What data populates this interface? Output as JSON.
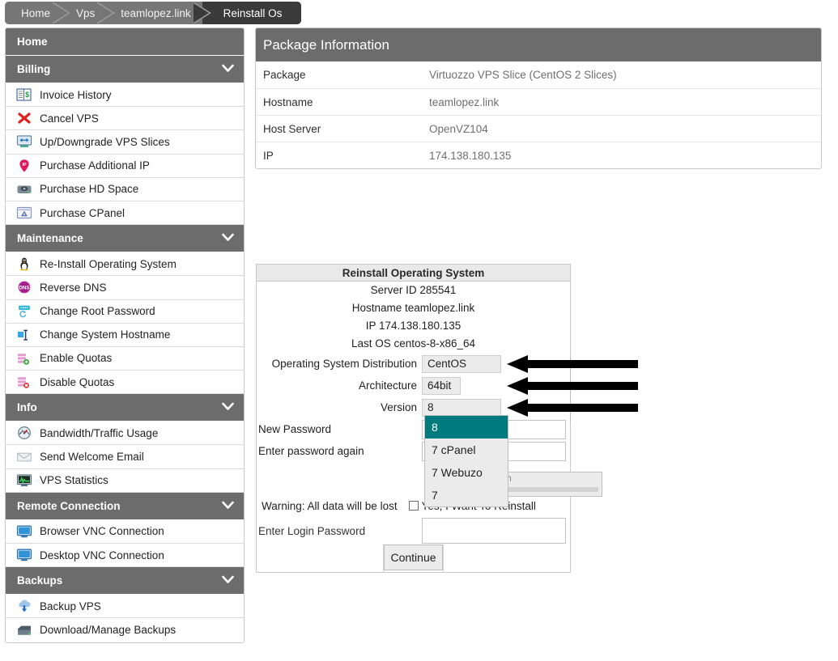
{
  "breadcrumb": {
    "items": [
      {
        "label": "Home",
        "active": false
      },
      {
        "label": "Vps",
        "active": false
      },
      {
        "label": "teamlopez.link",
        "active": false
      },
      {
        "label": "Reinstall Os",
        "active": true
      }
    ]
  },
  "sidebar": {
    "sections": [
      {
        "title": "Home",
        "caret": "",
        "items": []
      },
      {
        "title": "Billing",
        "caret": "⌄",
        "items": [
          {
            "label": "Invoice History",
            "icon": "invoice-icon"
          },
          {
            "label": "Cancel VPS",
            "icon": "red-x-icon"
          },
          {
            "label": "Up/Downgrade VPS Slices",
            "icon": "monitor-arrows-icon"
          },
          {
            "label": "Purchase Additional IP",
            "icon": "ip-pin-icon"
          },
          {
            "label": "Purchase HD Space",
            "icon": "harddisk-icon"
          },
          {
            "label": "Purchase CPanel",
            "icon": "cpanel-icon"
          }
        ]
      },
      {
        "title": "Maintenance",
        "caret": "⌄",
        "items": [
          {
            "label": "Re-Install Operating System",
            "icon": "linux-penguin-icon"
          },
          {
            "label": "Reverse DNS",
            "icon": "dns-icon"
          },
          {
            "label": "Change Root Password",
            "icon": "password-refresh-icon"
          },
          {
            "label": "Change System Hostname",
            "icon": "text-cursor-icon"
          },
          {
            "label": "Enable Quotas",
            "icon": "quota-add-icon"
          },
          {
            "label": "Disable Quotas",
            "icon": "quota-remove-icon"
          }
        ]
      },
      {
        "title": "Info",
        "caret": "⌄",
        "items": [
          {
            "label": "Bandwidth/Traffic Usage",
            "icon": "gauge-icon"
          },
          {
            "label": "Send Welcome Email",
            "icon": "envelope-icon"
          },
          {
            "label": "VPS Statistics",
            "icon": "stats-monitor-icon"
          }
        ]
      },
      {
        "title": "Remote Connection",
        "caret": "⌄",
        "items": [
          {
            "label": "Browser VNC Connection",
            "icon": "monitor-icon"
          },
          {
            "label": "Desktop VNC Connection",
            "icon": "monitor-icon"
          }
        ]
      },
      {
        "title": "Backups",
        "caret": "⌄",
        "items": [
          {
            "label": "Backup VPS",
            "icon": "download-cloud-icon"
          },
          {
            "label": "Download/Manage Backups",
            "icon": "archive-icon"
          }
        ]
      }
    ]
  },
  "package_panel": {
    "title": "Package Information",
    "rows": [
      {
        "key": "Package",
        "value": "Virtuozzo VPS Slice (CentOS 2 Slices)"
      },
      {
        "key": "Hostname",
        "value": "teamlopez.link"
      },
      {
        "key": "Host Server",
        "value": "OpenVZ104"
      },
      {
        "key": "IP",
        "value": "174.138.180.135"
      }
    ]
  },
  "reinstall_form": {
    "title": "Reinstall Operating System",
    "info_lines": [
      "Server ID 285541",
      "Hostname teamlopez.link",
      "IP 174.138.180.135",
      "Last OS centos-8-x86_64"
    ],
    "fields": {
      "os_label": "Operating System Distribution",
      "os_value": "CentOS",
      "arch_label": "Architecture",
      "arch_value": "64bit",
      "version_label": "Version",
      "version_value": "8"
    },
    "version_options": [
      "8",
      "7 cPanel",
      "7 Webuzo",
      "7"
    ],
    "version_selected": "8",
    "new_password_label": "New Password",
    "new_password_value": "",
    "confirm_password_label": "Enter password again",
    "confirm_password_value": "",
    "password_strength_text": "ength",
    "warning_text": "Warning: All data will be lost",
    "confirm_checkbox_label": "Yes, I Want To Reinstall",
    "confirm_checkbox_checked": false,
    "login_password_label": "Enter Login Password",
    "login_password_value": "",
    "continue_label": "Continue"
  },
  "annotations": {
    "arrow_count": 3,
    "arrow_color": "#000000",
    "arrow_direction": "left"
  },
  "colors": {
    "header_gray": "#6d6c6d",
    "breadcrumb_gray": "#777677",
    "breadcrumb_active": "#3b3a3b",
    "dropdown_highlight": "#007b7d",
    "border_gray": "#c9c9c9"
  }
}
